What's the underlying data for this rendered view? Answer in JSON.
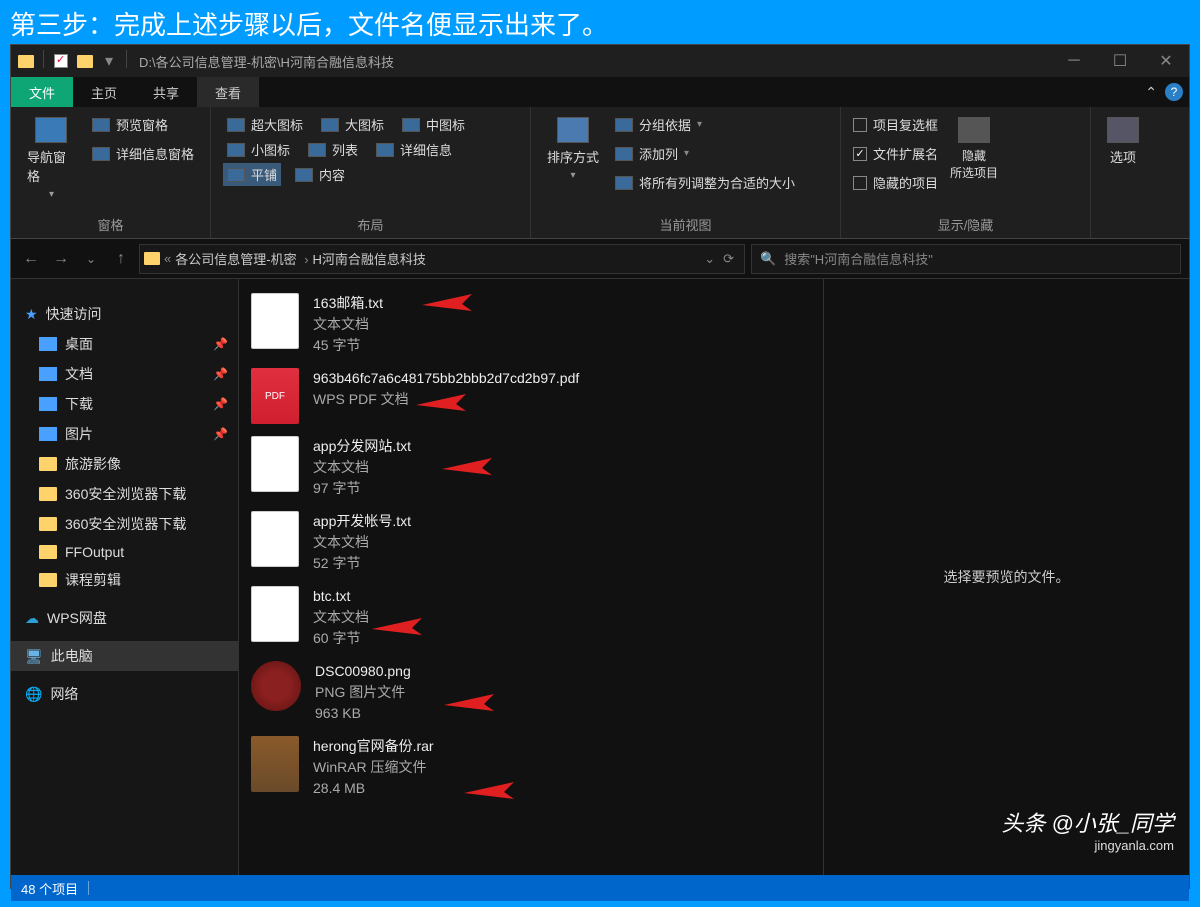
{
  "banner": "第三步：完成上述步骤以后，文件名便显示出来了。",
  "titlebar": {
    "path": "D:\\各公司信息管理-机密\\H河南合融信息科技"
  },
  "tabs": {
    "file": "文件",
    "home": "主页",
    "share": "共享",
    "view": "查看"
  },
  "ribbon": {
    "pane": {
      "nav": "导航窗格",
      "preview": "预览窗格",
      "details": "详细信息窗格",
      "label": "窗格"
    },
    "layout": {
      "xl": "超大图标",
      "lg": "大图标",
      "md": "中图标",
      "sm": "小图标",
      "list": "列表",
      "detail": "详细信息",
      "tile": "平铺",
      "content": "内容",
      "label": "布局"
    },
    "view": {
      "sort": "排序方式",
      "group": "分组依据",
      "addcol": "添加列",
      "fit": "将所有列调整为合适的大小",
      "label": "当前视图"
    },
    "show": {
      "chk": "项目复选框",
      "ext": "文件扩展名",
      "hidden": "隐藏的项目",
      "hide": "隐藏\n所选项目",
      "label": "显示/隐藏"
    },
    "options": "选项"
  },
  "breadcrumb": {
    "b1": "各公司信息管理-机密",
    "b2": "H河南合融信息科技"
  },
  "search_placeholder": "搜索\"H河南合融信息科技\"",
  "sidebar": {
    "quick": "快速访问",
    "desktop": "桌面",
    "docs": "文档",
    "downloads": "下载",
    "pics": "图片",
    "s1": "旅游影像",
    "s2": "360安全浏览器下载",
    "s3": "360安全浏览器下载",
    "s4": "FFOutput",
    "s5": "课程剪辑",
    "wps": "WPS网盘",
    "thispc": "此电脑",
    "network": "网络"
  },
  "files": [
    {
      "name": "163邮箱.txt",
      "type": "文本文档",
      "size": "45 字节",
      "ico": "txt"
    },
    {
      "name": "963b46fc7a6c48175bb2bbb2d7cd2b97.pdf",
      "type": "WPS PDF 文档",
      "size": "",
      "ico": "pdf"
    },
    {
      "name": "app分发网站.txt",
      "type": "文本文档",
      "size": "97 字节",
      "ico": "txt"
    },
    {
      "name": "app开发帐号.txt",
      "type": "文本文档",
      "size": "52 字节",
      "ico": "txt"
    },
    {
      "name": "btc.txt",
      "type": "文本文档",
      "size": "60 字节",
      "ico": "txt"
    },
    {
      "name": "DSC00980.png",
      "type": "PNG 图片文件",
      "size": "963 KB",
      "ico": "png"
    },
    {
      "name": "herong官网备份.rar",
      "type": "WinRAR 压缩文件",
      "size": "28.4 MB",
      "ico": "rar"
    }
  ],
  "preview_msg": "选择要预览的文件。",
  "status": {
    "count": "48 个项目"
  },
  "watermark": {
    "l1": "头条 @小张_同学",
    "l2": "jingyanla.com"
  }
}
